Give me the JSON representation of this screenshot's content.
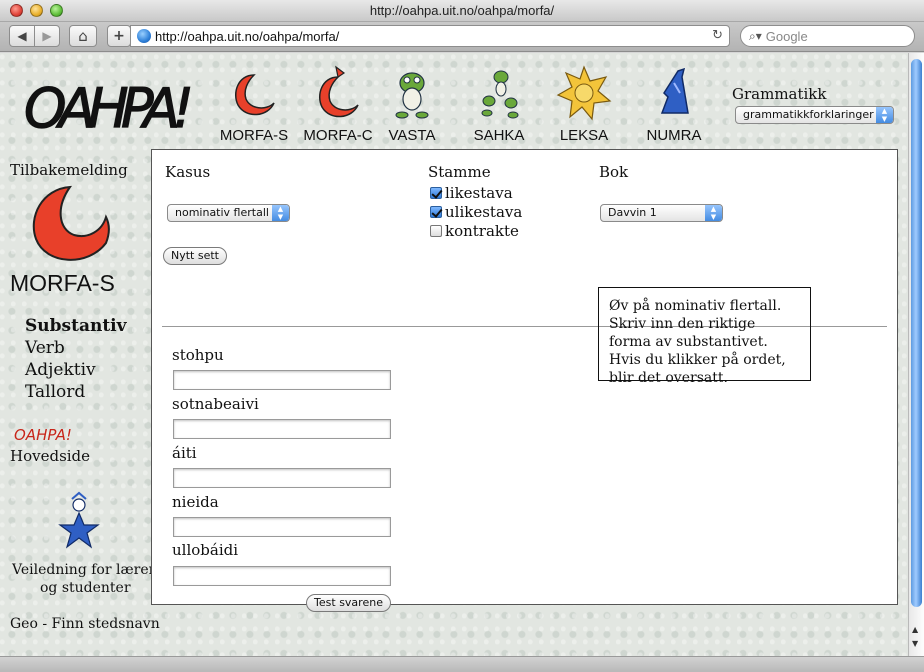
{
  "window": {
    "title": "http://oahpa.uit.no/oahpa/morfa/"
  },
  "toolbar": {
    "back_icon": "◀",
    "forward_icon": "▶",
    "home_icon": "⌂",
    "add_icon": "+",
    "url": "http://oahpa.uit.no/oahpa/morfa/",
    "reload_icon": "↻",
    "search_placeholder": "Google",
    "search_icon": "⌕▾"
  },
  "header": {
    "logo_text": "OAHPA!",
    "nav": [
      {
        "label": "MORFA-S",
        "icon": "red-crescent"
      },
      {
        "label": "MORFA-C",
        "icon": "red-crescent-leaf"
      },
      {
        "label": "VASTA",
        "icon": "green-frog"
      },
      {
        "label": "SAHKA",
        "icon": "frog-pair"
      },
      {
        "label": "LEKSA",
        "icon": "yellow-sun"
      },
      {
        "label": "NUMRA",
        "icon": "blue-figure"
      }
    ],
    "grammar_label": "Grammatikk",
    "grammar_select": "grammatikkforklaringer"
  },
  "sidebar": {
    "feedback_label": "Tilbakemelding",
    "title": "MORFA-S",
    "items": [
      "Substantiv",
      "Verb",
      "Adjektiv",
      "Tallord"
    ],
    "active_item": "Substantiv",
    "small_logo": "OAHPA!",
    "home_link": "Hovedside",
    "guide_link_line1": "Veiledning for lærere",
    "guide_link_line2": "og studenter",
    "geo_link": "Geo - Finn stedsnavn"
  },
  "form": {
    "kasus_label": "Kasus",
    "kasus_value": "nominativ flertall",
    "stamme_label": "Stamme",
    "stems": [
      {
        "label": "likestava",
        "checked": true
      },
      {
        "label": "ulikestava",
        "checked": true
      },
      {
        "label": "kontrakte",
        "checked": false
      }
    ],
    "bok_label": "Bok",
    "bok_value": "Davvin 1",
    "new_set_button": "Nytt sett",
    "words": [
      "stohpu",
      "sotnabeaivi",
      "áiti",
      "nieida",
      "ullobáidi"
    ],
    "answers": [
      "",
      "",
      "",
      "",
      ""
    ],
    "submit_button": "Test svarene",
    "instructions": "Øv på nominativ flertall. Skriv inn den riktige forma av substantivet. Hvis du klikker på ordet, blir det oversatt."
  },
  "colors": {
    "accent_red": "#e8402a",
    "accent_blue": "#2f5fc4",
    "scroll_blue": "#5e9be0"
  }
}
